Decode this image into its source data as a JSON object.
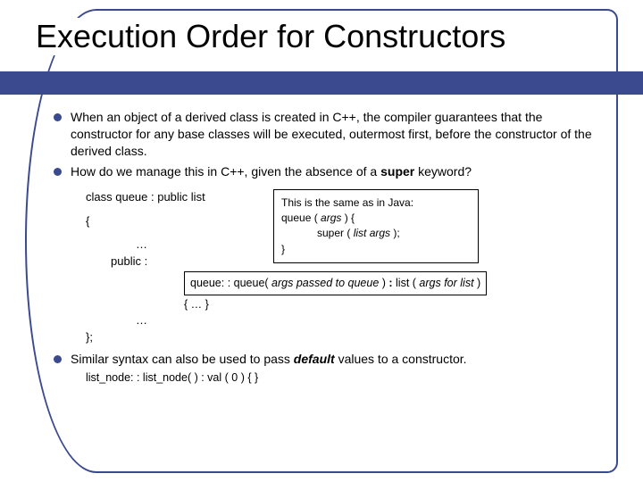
{
  "title": "Execution Order for Constructors",
  "bullets": {
    "b1": "When an object of a derived class is created in C++, the compiler guarantees that the constructor for any base classes will be executed, outermost first, before the constructor of the derived class.",
    "b2_pre": "How do we manage this in C++, given the absence of a ",
    "b2_kw": "super",
    "b2_post": " keyword?",
    "b3_pre": "Similar syntax can also be used to pass ",
    "b3_kw": "default",
    "b3_post": " values to a constructor."
  },
  "code": {
    "l1": "class queue : public list",
    "l2": "{",
    "l3": "…",
    "l4": "public :",
    "l5": "…",
    "l6": "};"
  },
  "java": {
    "j1": "This is the same as in Java:",
    "j2_a": "queue ( ",
    "j2_b": "args",
    "j2_c": " ) {",
    "j3_a": "super ( ",
    "j3_b": "list args",
    "j3_c": "  );",
    "j4": "}"
  },
  "cpp": {
    "c1_a": "queue: : queue( ",
    "c1_b": "args passed to queue",
    "c1_c": " ) ",
    "c1_d": ": ",
    "c1_e": "list ( ",
    "c1_f": "args for list",
    "c1_g": " )",
    "c2": "{ … }"
  },
  "footer": "list_node: : list_node( ) : val ( 0 ) { }"
}
